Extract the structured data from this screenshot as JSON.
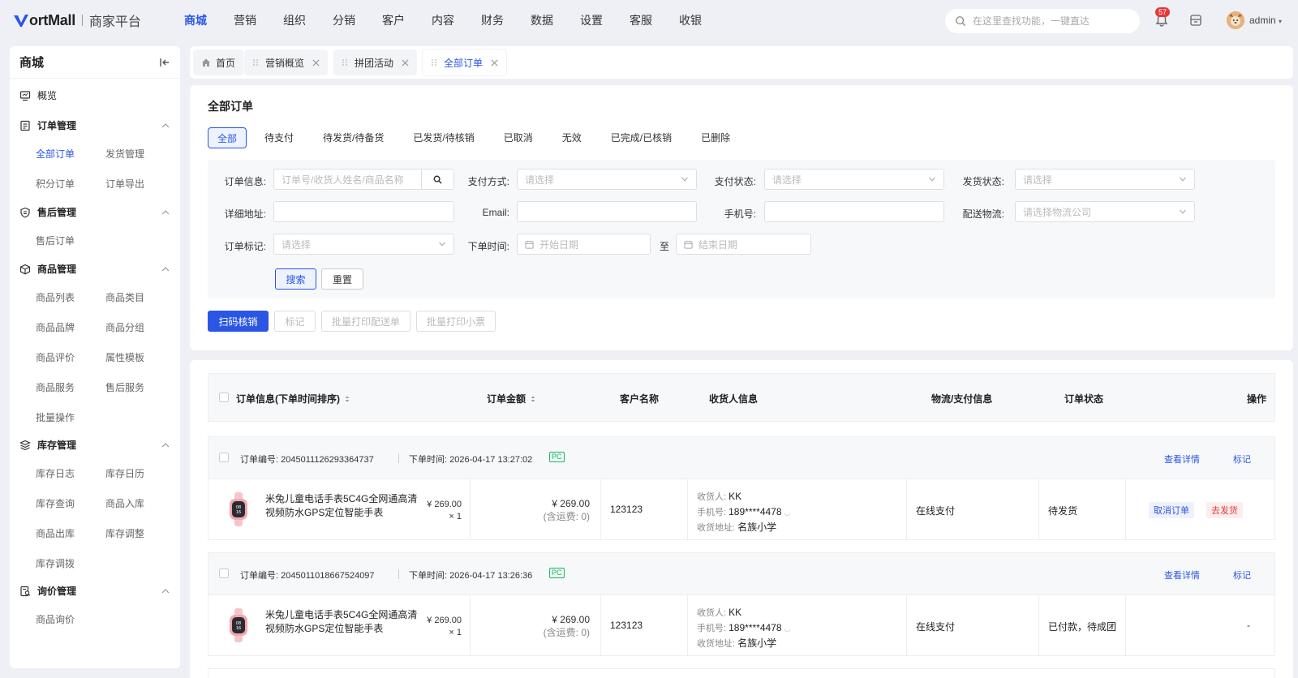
{
  "brand": {
    "name": "ortMall",
    "subtitle": "商家平台"
  },
  "topnav": [
    "商城",
    "营销",
    "组织",
    "分销",
    "客户",
    "内容",
    "财务",
    "数据",
    "设置",
    "客服",
    "收银"
  ],
  "topnav_active": 0,
  "search": {
    "placeholder": "在这里查找功能，一键直达"
  },
  "notifications": {
    "count": "57"
  },
  "user": {
    "name": "admin"
  },
  "sidebar": {
    "title": "商城",
    "overview": "概览",
    "groups": [
      {
        "label": "订单管理",
        "icon": "order-icon",
        "items": [
          "全部订单",
          "发货管理",
          "积分订单",
          "订单导出"
        ]
      },
      {
        "label": "售后管理",
        "icon": "aftersale-icon",
        "items": [
          "售后订单"
        ]
      },
      {
        "label": "商品管理",
        "icon": "goods-icon",
        "items": [
          "商品列表",
          "商品类目",
          "商品品牌",
          "商品分组",
          "商品评价",
          "属性模板",
          "商品服务",
          "售后服务",
          "批量操作"
        ]
      },
      {
        "label": "库存管理",
        "icon": "stock-icon",
        "items": [
          "库存日志",
          "库存日历",
          "库存查询",
          "商品入库",
          "商品出库",
          "库存调整",
          "库存调拨"
        ]
      },
      {
        "label": "询价管理",
        "icon": "inquiry-icon",
        "items": [
          "商品询价"
        ]
      }
    ]
  },
  "tabs": [
    {
      "label": "首页"
    },
    {
      "label": "营销概览"
    },
    {
      "label": "拼团活动"
    },
    {
      "label": "全部订单"
    }
  ],
  "page": {
    "title": "全部订单",
    "status_tabs": [
      "全部",
      "待支付",
      "待发货/待备货",
      "已发货/待核销",
      "已取消",
      "无效",
      "已完成/已核销",
      "已删除"
    ]
  },
  "filters": {
    "order_info": {
      "label": "订单信息:",
      "placeholder": "订单号/收货人姓名/商品名称"
    },
    "pay_method": {
      "label": "支付方式:",
      "placeholder": "请选择"
    },
    "pay_status": {
      "label": "支付状态:",
      "placeholder": "请选择"
    },
    "ship_status": {
      "label": "发货状态:",
      "placeholder": "请选择"
    },
    "address": {
      "label": "详细地址:",
      "placeholder": ""
    },
    "email": {
      "label": "Email:",
      "placeholder": ""
    },
    "phone": {
      "label": "手机号:",
      "placeholder": ""
    },
    "logistics": {
      "label": "配送物流:",
      "placeholder": "请选择物流公司"
    },
    "mark": {
      "label": "订单标记:",
      "placeholder": "请选择"
    },
    "order_time": {
      "label": "下单时间:",
      "start": "开始日期",
      "to": "至",
      "end": "结束日期"
    },
    "search_btn": "搜索",
    "reset_btn": "重置"
  },
  "actions": {
    "scan": "扫码核销",
    "mark": "标记",
    "print_delivery": "批量打印配送单",
    "print_receipt": "批量打印小票"
  },
  "table": {
    "headers": [
      "订单信息(下单时间排序)",
      "订单金额",
      "客户名称",
      "收货人信息",
      "物流/支付信息",
      "订单状态",
      "操作"
    ],
    "labels": {
      "order_no": "订单编号:",
      "order_time": "下单时间:",
      "view": "查看详情",
      "mark": "标记",
      "receiver": "收货人:",
      "phone": "手机号:",
      "address": "收货地址:",
      "shipping": "(含运费: 0)"
    },
    "orders": [
      {
        "order_no": "2045011126293364737",
        "time": "2026-04-17 13:27:02",
        "source": "PC",
        "product": "米兔儿童电话手表5C4G全网通高清视频防水GPS定位智能手表",
        "unit_price": "¥ 269.00",
        "qty": "× 1",
        "amount": "¥ 269.00",
        "customer": "123123",
        "receiver": "KK",
        "phone": "189****4478",
        "address": "名族小学",
        "payment": "在线支付",
        "status": "待发货",
        "ops": [
          "取消订单",
          "去发货"
        ]
      },
      {
        "order_no": "2045011018667524097",
        "time": "2026-04-17 13:26:36",
        "source": "PC",
        "product": "米兔儿童电话手表5C4G全网通高清视频防水GPS定位智能手表",
        "unit_price": "¥ 269.00",
        "qty": "× 1",
        "amount": "¥ 269.00",
        "customer": "123123",
        "receiver": "KK",
        "phone": "189****4478",
        "address": "名族小学",
        "payment": "在线支付",
        "status": "已付款，待成团",
        "ops": [
          "-"
        ]
      }
    ]
  },
  "colors": {
    "primary": "#2a55e5",
    "danger": "#e53935",
    "success": "#20b26c",
    "bg": "#eef0f6"
  }
}
